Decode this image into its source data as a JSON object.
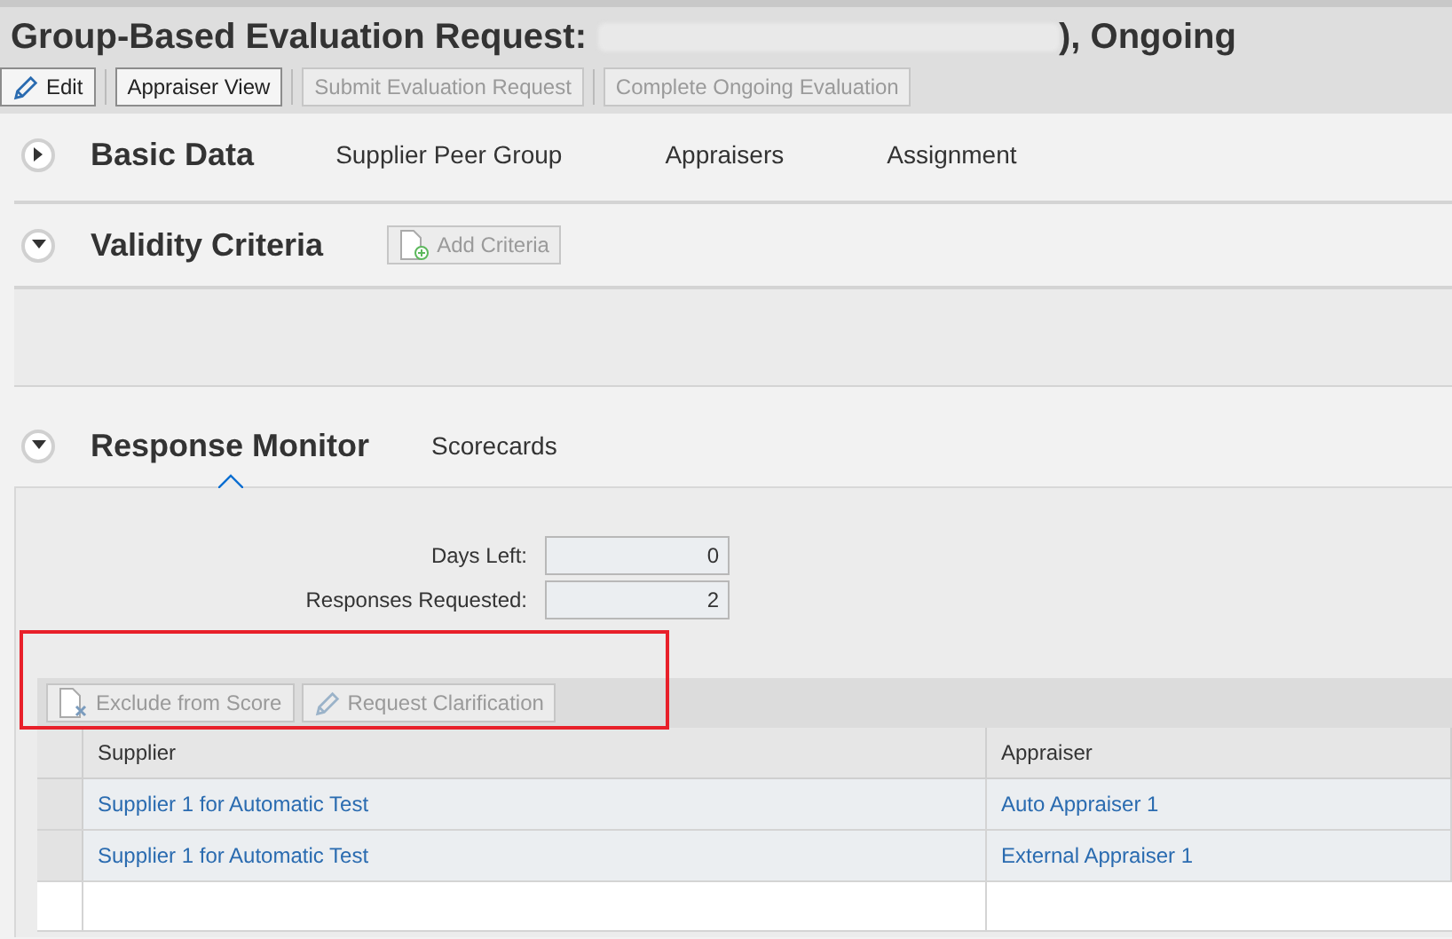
{
  "window": {
    "title": "Group-Based Evaluation Request:",
    "title_suffix": "), Ongoing"
  },
  "toolbar": [
    {
      "label": "Edit",
      "disabled": false
    },
    {
      "label": "Appraiser View",
      "disabled": false
    },
    {
      "label": "Submit Evaluation Request",
      "disabled": true
    },
    {
      "label": "Complete Ongoing Evaluation",
      "disabled": true
    }
  ],
  "sections": [
    {
      "kind": "tabs",
      "title": "Basic Data",
      "expanded": false,
      "tabs": [
        {
          "label": "Supplier Peer Group",
          "selected": false
        },
        {
          "label": "Appraisers",
          "selected": false
        },
        {
          "label": "Assignment",
          "selected": false
        }
      ]
    },
    {
      "kind": "criteria",
      "title": "Validity Criteria",
      "expanded": true,
      "button": {
        "label": "Add Criteria",
        "disabled": true
      }
    },
    {
      "kind": "monitor",
      "title": "Response Monitor",
      "expanded": true,
      "selected": true,
      "tabs": [
        {
          "label": "Scorecards",
          "selected": false
        }
      ],
      "fields": [
        {
          "label": "Days Left:",
          "value": "0"
        },
        {
          "label": "Responses Requested:",
          "value": "2"
        }
      ],
      "table_toolbar": [
        {
          "label": "Exclude from Score",
          "disabled": true
        },
        {
          "label": "Request Clarification",
          "disabled": true
        }
      ],
      "table": {
        "columns": [
          "Supplier",
          "Appraiser"
        ],
        "rows": [
          [
            "Supplier 1 for Automatic Test",
            "Auto Appraiser 1"
          ],
          [
            "Supplier 1 for Automatic Test",
            "External Appraiser 1"
          ]
        ]
      }
    }
  ]
}
